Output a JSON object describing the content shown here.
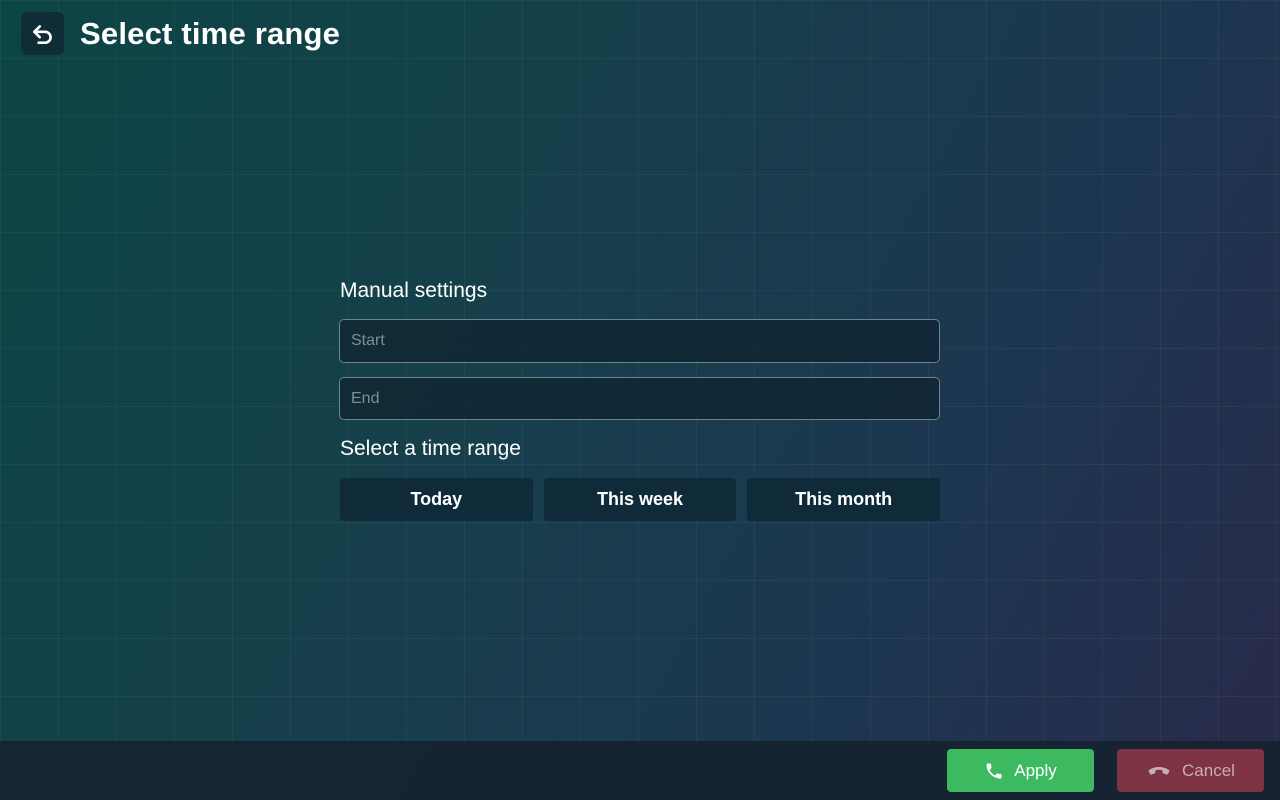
{
  "header": {
    "title": "Select time range",
    "back_icon": "undo-arrow-icon"
  },
  "manual": {
    "label": "Manual settings",
    "start_placeholder": "Start",
    "start_value": "",
    "end_placeholder": "End",
    "end_value": ""
  },
  "ranges": {
    "label": "Select a time range",
    "options": [
      "Today",
      "This week",
      "This month"
    ]
  },
  "footer": {
    "apply_label": "Apply",
    "apply_icon": "phone-icon",
    "cancel_label": "Cancel",
    "cancel_icon": "hang-up-icon"
  },
  "colors": {
    "apply": "#3dba60",
    "cancel": "#7d3344",
    "range_button": "#0f2b39"
  }
}
